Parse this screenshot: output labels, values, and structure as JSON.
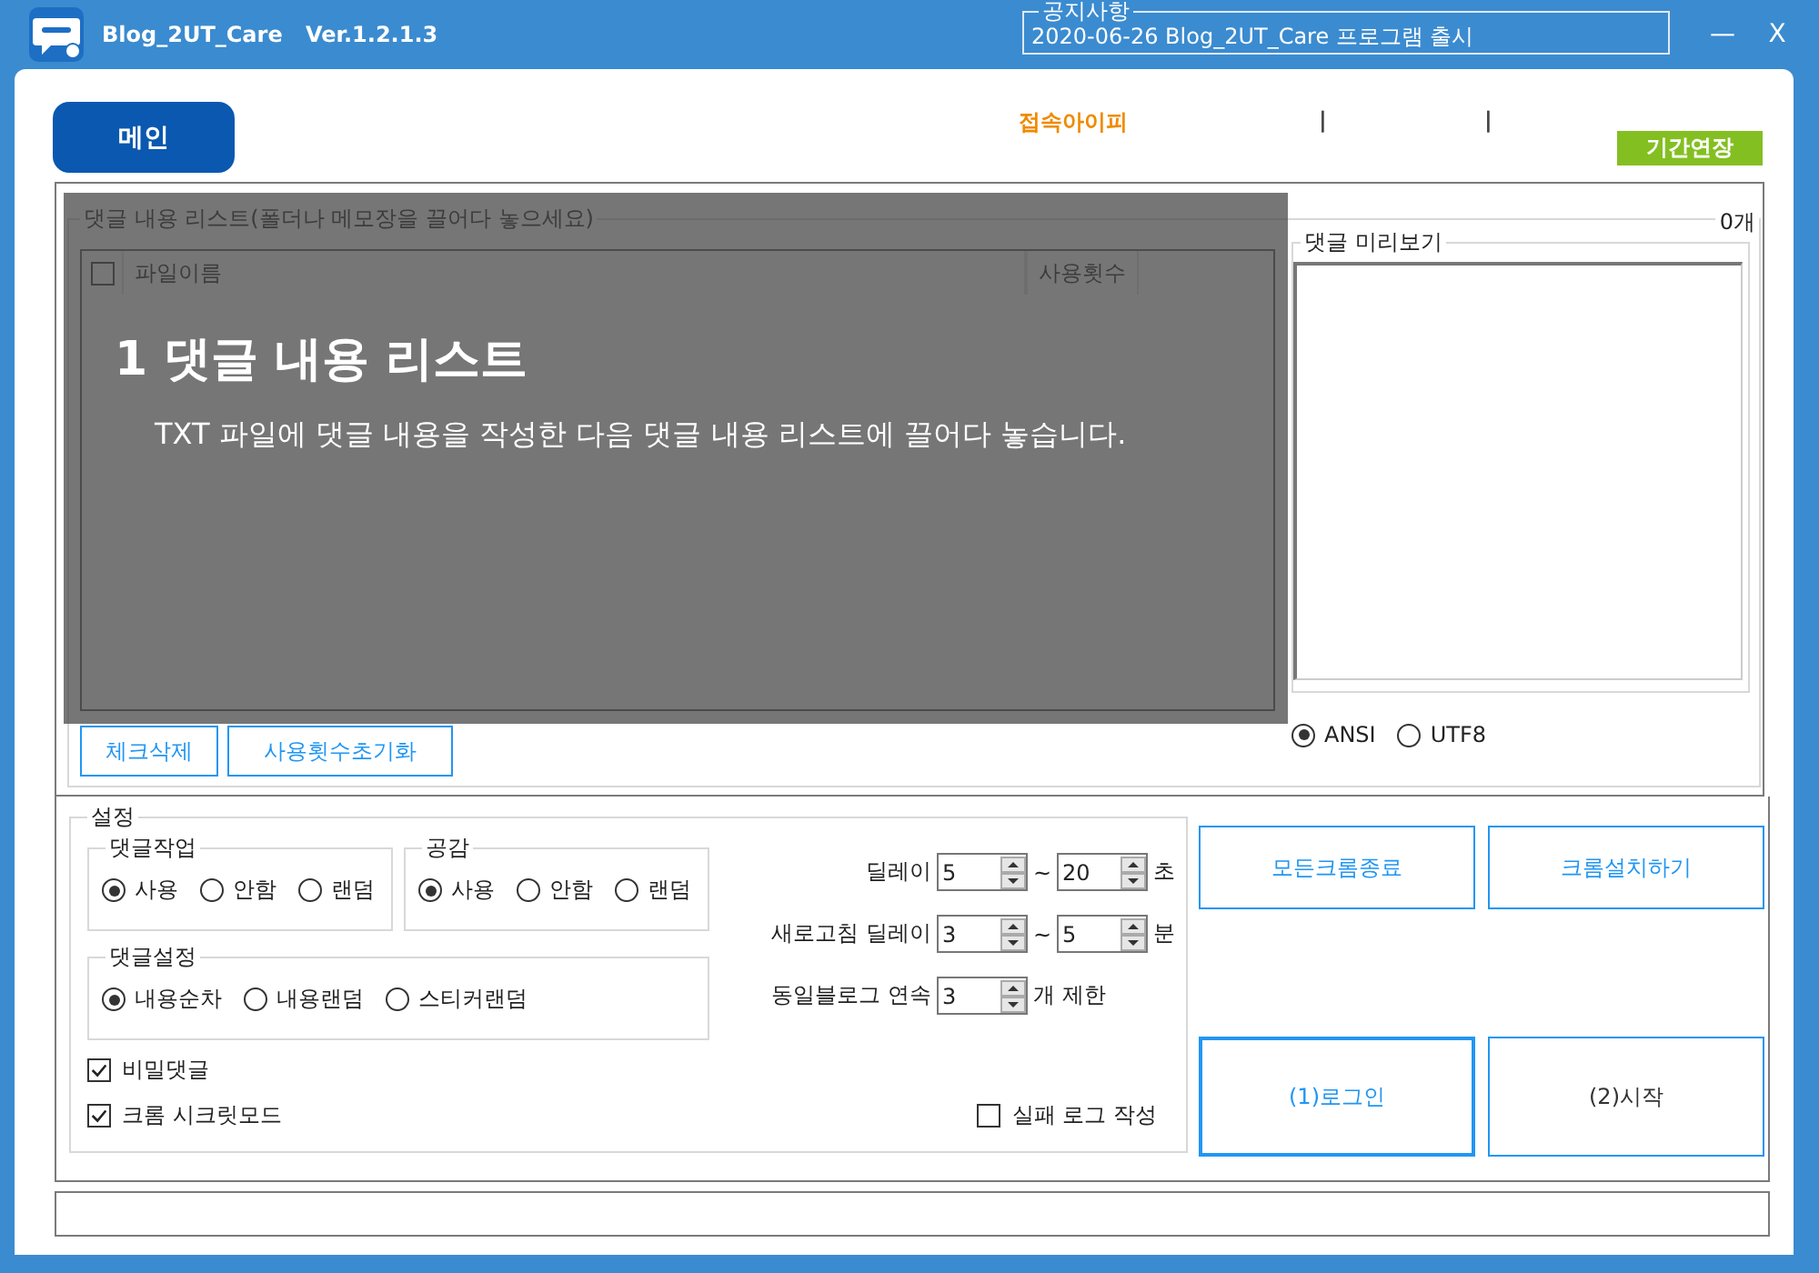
{
  "window": {
    "title": "Blog_2UT_Care",
    "version": "Ver.1.2.1.3",
    "minimize": "—",
    "close": "X"
  },
  "notice": {
    "label": "공지사항",
    "text": "2020-06-26 Blog_2UT_Care 프로그램 출시"
  },
  "header": {
    "main_button": "메인",
    "ip_label": "접속아이피",
    "separators": [
      "|",
      "|"
    ],
    "extend_button": "기간연장"
  },
  "comment_list": {
    "title": "댓글 내용 리스트(폴더나 메모장을 끌어다 놓으세요)",
    "count": "0개",
    "select_all_checked": false,
    "columns": [
      "파일이름",
      "사용횟수"
    ],
    "buttons": [
      "체크삭제",
      "사용횟수초기화"
    ]
  },
  "preview": {
    "title": "댓글 미리보기"
  },
  "encoding": [
    {
      "label": "ANSI",
      "selected": true
    },
    {
      "label": "UTF8",
      "selected": false
    }
  ],
  "settings": {
    "title": "설정",
    "groups": [
      {
        "title": "댓글작업",
        "options": [
          {
            "label": "사용",
            "selected": true
          },
          {
            "label": "안함",
            "selected": false
          },
          {
            "label": "랜덤",
            "selected": false
          }
        ]
      },
      {
        "title": "공감",
        "options": [
          {
            "label": "사용",
            "selected": true
          },
          {
            "label": "안함",
            "selected": false
          },
          {
            "label": "랜덤",
            "selected": false
          }
        ]
      },
      {
        "title": "댓글설정",
        "options": [
          {
            "label": "내용순차",
            "selected": true
          },
          {
            "label": "내용랜덤",
            "selected": false
          },
          {
            "label": "스티커랜덤",
            "selected": false
          }
        ]
      }
    ],
    "spinners": [
      {
        "label": "딜레이",
        "from": "5",
        "range_mark": "~",
        "to": "20",
        "unit": "초"
      },
      {
        "label": "새로고침 딜레이",
        "from": "3",
        "range_mark": "~",
        "to": "5",
        "unit": "분"
      },
      {
        "label": "동일블로그 연속",
        "from": "3",
        "unit": "개 제한"
      }
    ],
    "checks": [
      {
        "label": "비밀댓글",
        "checked": true
      },
      {
        "label": "크롬 시크릿모드",
        "checked": true
      },
      {
        "label": "실패 로그 작성",
        "checked": false
      }
    ]
  },
  "actions": [
    {
      "label": "모든크롬종료",
      "kind": "accent",
      "focused": false
    },
    {
      "label": "크롬설치하기",
      "kind": "accent",
      "focused": false
    },
    {
      "label": "(1)로그인",
      "kind": "accent",
      "focused": true
    },
    {
      "label": "(2)시작",
      "kind": "plain",
      "focused": false
    }
  ],
  "tutorial": {
    "title": "1 댓글 내용 리스트",
    "text": "TXT 파일에 댓글 내용을 작성한 다음 댓글 내용 리스트에 끌어다 놓습니다."
  }
}
